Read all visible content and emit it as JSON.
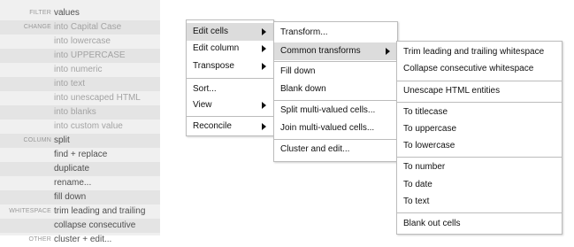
{
  "facets": {
    "top_partial": "values",
    "rows": [
      {
        "category": "filter",
        "label": "values",
        "dim": false
      },
      {
        "category": "change",
        "label": "into Capital Case",
        "dim": true
      },
      {
        "category": "",
        "label": "into lowercase",
        "dim": true
      },
      {
        "category": "",
        "label": "into UPPERCASE",
        "dim": true
      },
      {
        "category": "",
        "label": "into numeric",
        "dim": true
      },
      {
        "category": "",
        "label": "into text",
        "dim": true
      },
      {
        "category": "",
        "label": "into unescaped HTML",
        "dim": true
      },
      {
        "category": "",
        "label": "into blanks",
        "dim": true
      },
      {
        "category": "",
        "label": "into custom value",
        "dim": true
      },
      {
        "category": "column",
        "label": "split",
        "dim": false
      },
      {
        "category": "",
        "label": "find + replace",
        "dim": false
      },
      {
        "category": "",
        "label": "duplicate",
        "dim": false
      },
      {
        "category": "",
        "label": "rename...",
        "dim": false
      },
      {
        "category": "",
        "label": "fill down",
        "dim": false
      },
      {
        "category": "whitespace",
        "label": "trim leading and trailing",
        "dim": false
      },
      {
        "category": "",
        "label": "collapse consecutive",
        "dim": false
      },
      {
        "category": "other",
        "label": "cluster + edit...",
        "dim": false
      }
    ]
  },
  "menu1": {
    "items": [
      "Edit cells",
      "Edit column",
      "Transpose",
      "Sort...",
      "View",
      "Reconcile"
    ]
  },
  "menu2": {
    "items": [
      "Transform...",
      "Common transforms",
      "Fill down",
      "Blank down",
      "Split multi-valued cells...",
      "Join multi-valued cells...",
      "Cluster and edit..."
    ]
  },
  "menu3": {
    "items": [
      "Trim leading and trailing whitespace",
      "Collapse consecutive whitespace",
      "Unescape HTML entities",
      "To titlecase",
      "To uppercase",
      "To lowercase",
      "To number",
      "To date",
      "To text",
      "Blank out cells"
    ]
  },
  "colors": {
    "panel_bg": "#f0f0f0",
    "stripe_bg": "#e4e4e4",
    "category_text": "#999999",
    "dim_text": "#a3a3a3",
    "menu_border": "#bcbcbc",
    "menu_highlight": "#dcdcdc"
  },
  "icons": [
    "submenu-arrow-icon"
  ]
}
